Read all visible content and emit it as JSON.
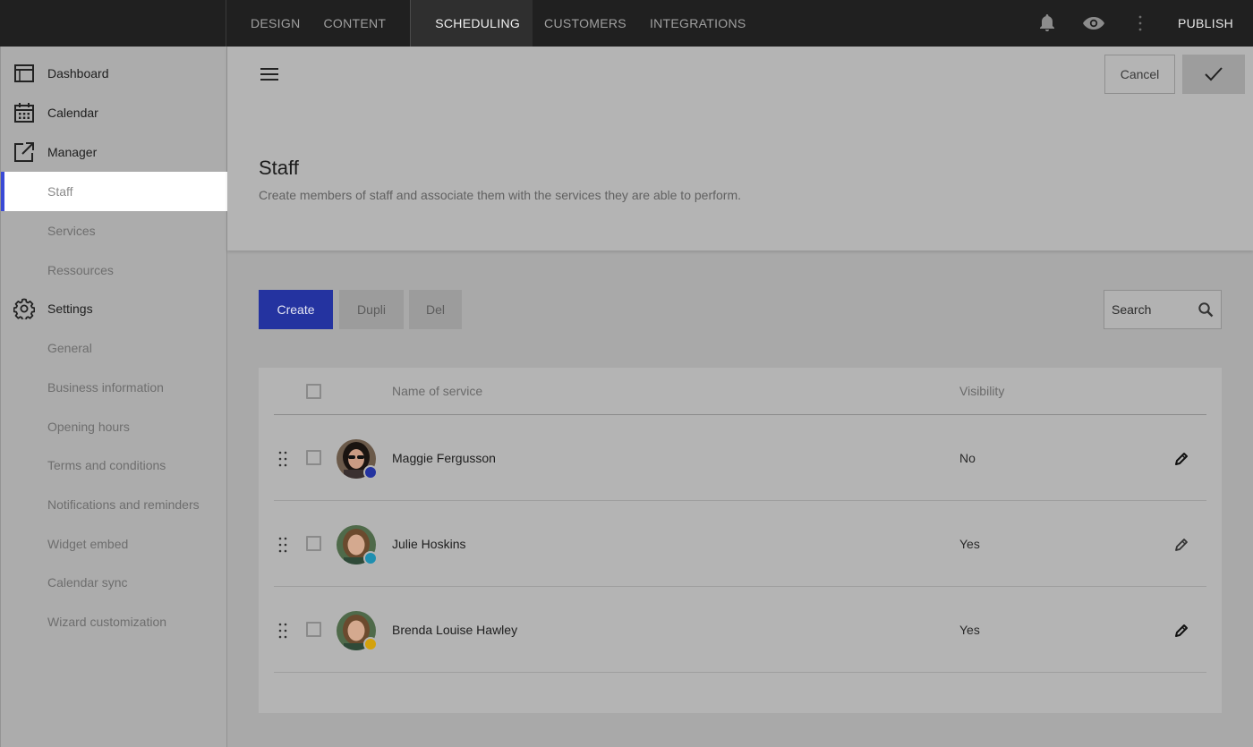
{
  "topnav": {
    "tabs": [
      {
        "label": "DESIGN"
      },
      {
        "label": "CONTENT"
      },
      {
        "label": "SCHEDULING",
        "active": true
      },
      {
        "label": "CUSTOMERS"
      },
      {
        "label": "INTEGRATIONS"
      }
    ],
    "icons": [
      "bell-icon",
      "eye-icon",
      "more-vertical-icon"
    ],
    "publish_label": "PUBLISH"
  },
  "sidebar": {
    "items": [
      {
        "label": "Dashboard",
        "icon": "dashboard-icon"
      },
      {
        "label": "Calendar",
        "icon": "calendar-icon"
      },
      {
        "label": "Manager",
        "icon": "external-link-icon"
      },
      {
        "label": "Staff",
        "active": true
      },
      {
        "label": "Services"
      },
      {
        "label": "Ressources"
      },
      {
        "label": "Settings",
        "icon": "gear-icon"
      },
      {
        "label": "General"
      },
      {
        "label": "Business information"
      },
      {
        "label": "Opening hours"
      },
      {
        "label": "Terms and conditions"
      },
      {
        "label": "Notifications and reminders"
      },
      {
        "label": "Widget embed"
      },
      {
        "label": "Calendar sync"
      },
      {
        "label": "Wizard customization"
      }
    ]
  },
  "header": {
    "cancel_label": "Cancel",
    "title": "Staff",
    "subtitle": "Create members of staff and associate them with the services they are able to perform."
  },
  "actions": {
    "create_label": "Create",
    "dupli_label": "Dupli",
    "del_label": "Del",
    "search_placeholder": "Search"
  },
  "table": {
    "columns": {
      "name": "Name of service",
      "visibility": "Visibility"
    },
    "rows": [
      {
        "name": "Maggie Fergusson",
        "visibility": "No",
        "status_color": "#2433a0"
      },
      {
        "name": "Julie Hoskins",
        "visibility": "Yes",
        "status_color": "#1f8fb0"
      },
      {
        "name": "Brenda Louise Hawley",
        "visibility": "Yes",
        "status_color": "#d4a20c"
      }
    ]
  },
  "colors": {
    "accent": "#3a4ad6",
    "primary_button": "#2433a0",
    "topbar": "#202020"
  }
}
